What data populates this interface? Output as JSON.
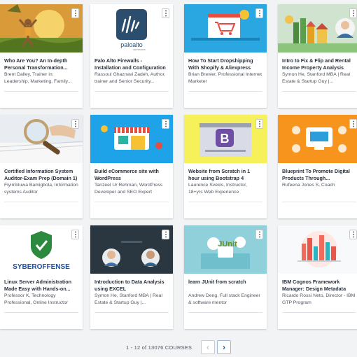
{
  "courses": [
    {
      "title": "Who Are You? An In-depth Personal Transformation...",
      "instructor": "Brent Dalley, Trainer in: Leadership, Marketing, Family...",
      "menu": "⋮",
      "thumb": "man-sunset-illustration"
    },
    {
      "title": "Palo Alto Firewalls - Installation and Configuration",
      "instructor": "Rassoul Ghaznavi Zadeh, Author, trainer and Senior Security...",
      "menu": "⋮",
      "thumb": "paloalto-logo",
      "logo_text": "paloalto",
      "logo_sub": "NETWORKS"
    },
    {
      "title": "How To Start Dropshipping With Shopify & Aliexpress",
      "instructor": "Brian Brewer, Professional Internet Marketer",
      "menu": "⋮",
      "thumb": "shopping-cart-illustration"
    },
    {
      "title": "Intro to Fix & Flip and Rental Income Property Analysis",
      "instructor": "Symon He, Stanford MBA | Real Estate & Startup Guy |...",
      "menu": "⋮",
      "thumb": "houses-illustration"
    },
    {
      "title": "Certified Information System Auditor-Exam Prep (Domain 1)",
      "instructor": "Fiyinfoluwa Bamigbola, Information systems Auditor",
      "menu": "⋮",
      "thumb": "magnifier-illustration"
    },
    {
      "title": "Build eCommerce site with WordPress",
      "instructor": "Tanzeel Ur Rehman, WordPress Developer and SEO Expert",
      "menu": "⋮",
      "thumb": "storefront-illustration"
    },
    {
      "title": "Website from Scratch in 1 hour using Bootstrap 4",
      "instructor": "Laurence Svekis, Instructor, 18+yrs Web Experience",
      "menu": "⋮",
      "thumb": "bootstrap-logo",
      "logo_text": "B"
    },
    {
      "title": "Blueprint To Promote Digital Products Through...",
      "instructor": "Rufeena Jones S, Coach",
      "menu": "⋮",
      "thumb": "digital-products-illustration"
    },
    {
      "title": "Linux Server Administration Made Easy with Hands-on...",
      "instructor": "Professor K, Technology Professional, Online Instructor",
      "menu": "⋮",
      "thumb": "syberoffense-logo",
      "logo_text": "SYBEROFFENSE"
    },
    {
      "title": "Introduction to Data Analysis using EXCEL",
      "instructor": "Symon He, Stanford MBA | Real Estate & Startup Guy |...",
      "menu": "⋮",
      "thumb": "instructors-photo"
    },
    {
      "title": "learn JUnit from scratch",
      "instructor": "Andrew Deng, Full stack Engineer & software mentor",
      "menu": "⋮",
      "thumb": "junit-logo",
      "logo_text": "JUnit"
    },
    {
      "title": "IBM Cognos Framework Manager: Design Metadata",
      "instructor": "Ricardo Rossi Neto, Director - IBM GTP Program",
      "menu": "⋮",
      "thumb": "city-skyline-illustration"
    }
  ],
  "pagination": {
    "summary": "1 - 12 of 13076 COURSES",
    "prev": "‹",
    "next": "›"
  }
}
